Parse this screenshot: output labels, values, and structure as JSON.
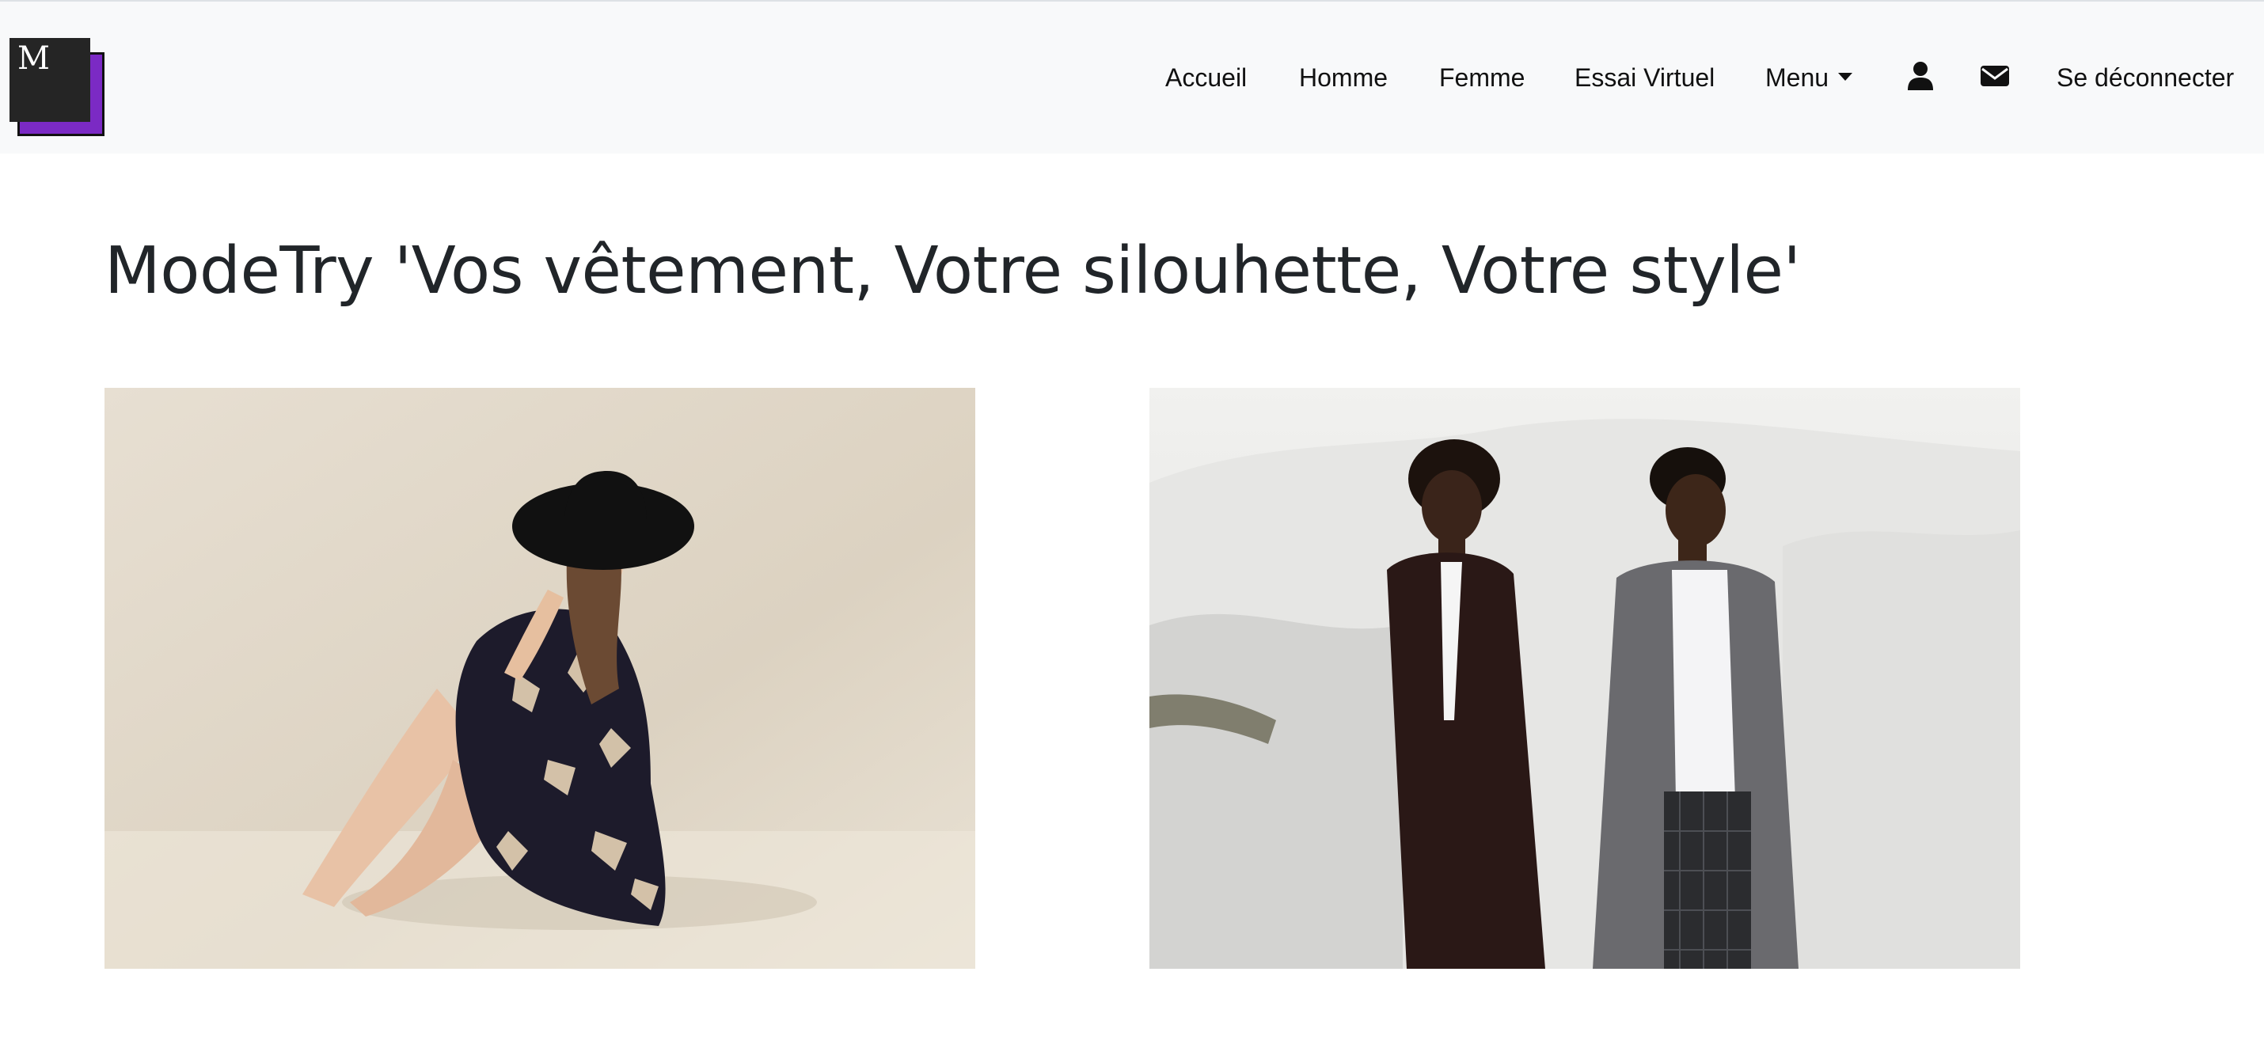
{
  "logo": {
    "letter": "M"
  },
  "nav": {
    "accueil": "Accueil",
    "homme": "Homme",
    "femme": "Femme",
    "essai": "Essai Virtuel",
    "menu": "Menu",
    "logout": "Se déconnecter",
    "icons": [
      "user-icon",
      "envelope-icon"
    ]
  },
  "main": {
    "title": "ModeTry 'Vos vêtement, Votre silouhette, Votre style'"
  },
  "colors": {
    "navbar_bg": "#f8f9fa",
    "logo_accent": "#7b2ac4",
    "text": "#212529"
  }
}
